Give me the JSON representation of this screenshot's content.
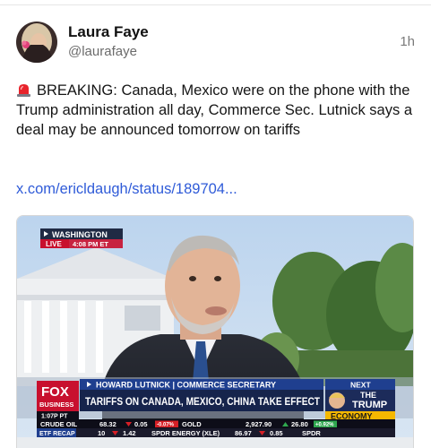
{
  "post": {
    "display_name": "Laura Faye",
    "handle": "@laurafaye",
    "time": "1h",
    "avatar_icon": "profile-photo",
    "siren_icon": "rotating-light-icon",
    "text": "BREAKING: Canada, Mexico were on the phone with the Trump administration all day, Commerce Sec. Lutnick says a deal may be announced tomorrow on tariffs",
    "link": "x.com/ericldaugh/status/189704..."
  },
  "media": {
    "location_tag": "WASHINGTON",
    "live_label": "LIVE",
    "live_time": "4:08 PM ET",
    "network_top": "FOX",
    "network_bottom": "BUSINESS",
    "local_time": "1:07P PT",
    "name_strap": "HOWARD LUTNICK | COMMERCE SECRETARY",
    "headline": "TARIFFS ON CANADA, MEXICO, CHINA TAKE EFFECT",
    "next_label": "NEXT",
    "next_show_top": "THE",
    "next_show_mid": "TRUMP",
    "next_show_bottom": "ECONOMY",
    "ticker_row1": {
      "crude_label": "CRUDE OIL",
      "crude_price": "68.32",
      "crude_change": "0.05",
      "crude_pct": "-0.07%",
      "gold_label": "GOLD",
      "gold_price": "2,927.90",
      "gold_change": "26.80",
      "gold_pct": "+0.92%"
    },
    "ticker_row2": {
      "etf_label": "ETF RECAP",
      "etf_val1": "10",
      "etf_val2": "1.42",
      "spdr_label": "SPDR ENERGY (XLE)",
      "spdr_price": "86.97",
      "spdr_change": "0.85",
      "spdr_tail": "SPDR"
    },
    "colors": {
      "fox_red": "#c8102e",
      "strap_blue": "#1f3f8f",
      "ticker_dark": "#0d0d18",
      "up_green": "#2fa84f",
      "down_red": "#d61f26",
      "economy_gold": "#f5b800"
    }
  }
}
